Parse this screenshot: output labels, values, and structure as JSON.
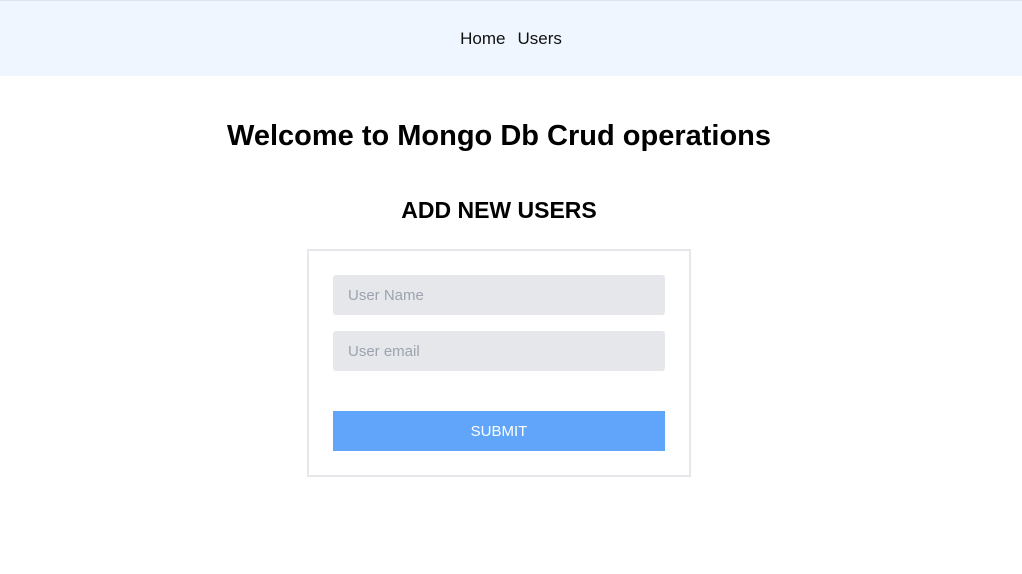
{
  "nav": {
    "items": [
      {
        "label": "Home"
      },
      {
        "label": "Users"
      }
    ]
  },
  "main": {
    "title": "Welcome to Mongo Db Crud operations",
    "section_title": "ADD NEW USERS"
  },
  "form": {
    "user_name": {
      "value": "",
      "placeholder": "User Name"
    },
    "user_email": {
      "value": "",
      "placeholder": "User email"
    },
    "submit_label": "SUBMIT"
  },
  "colors": {
    "navbar_bg": "#eff6ff",
    "input_bg": "#e5e7eb",
    "submit_bg": "#60a5fa",
    "card_border": "#e5e7eb"
  }
}
